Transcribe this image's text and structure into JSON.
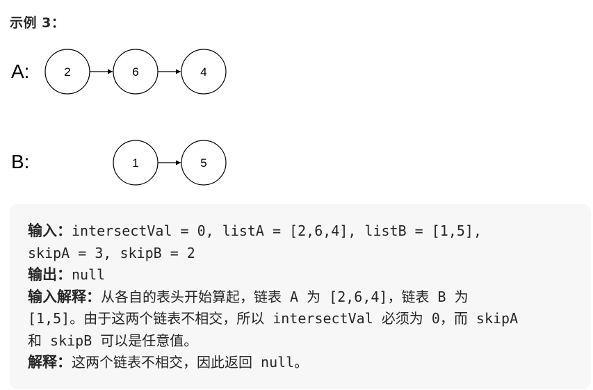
{
  "example": {
    "title": "示例 3："
  },
  "diagram": {
    "list_a": {
      "label": "A:",
      "nodes": [
        "2",
        "6",
        "4"
      ]
    },
    "list_b": {
      "label": "B:",
      "nodes": [
        "1",
        "5"
      ]
    }
  },
  "codebox": {
    "line1": {
      "label": "输入：",
      "text": "intersectVal = 0, listA = [2,6,4], listB = [1,5],"
    },
    "line2": {
      "text": "skipA = 3, skipB = 2"
    },
    "line3": {
      "label": "输出：",
      "text": "null"
    },
    "line4": {
      "label": "输入解释：",
      "text": "从各自的表头开始算起，链表 A 为 [2,6,4]，链表 B 为"
    },
    "line5": {
      "text": "[1,5]。由于这两个链表不相交，所以 intersectVal 必须为 0，而 skipA"
    },
    "line6": {
      "text": "和 skipB 可以是任意值。"
    },
    "line7": {
      "label": "解释：",
      "text": "这两个链表不相交，因此返回 null。"
    }
  }
}
